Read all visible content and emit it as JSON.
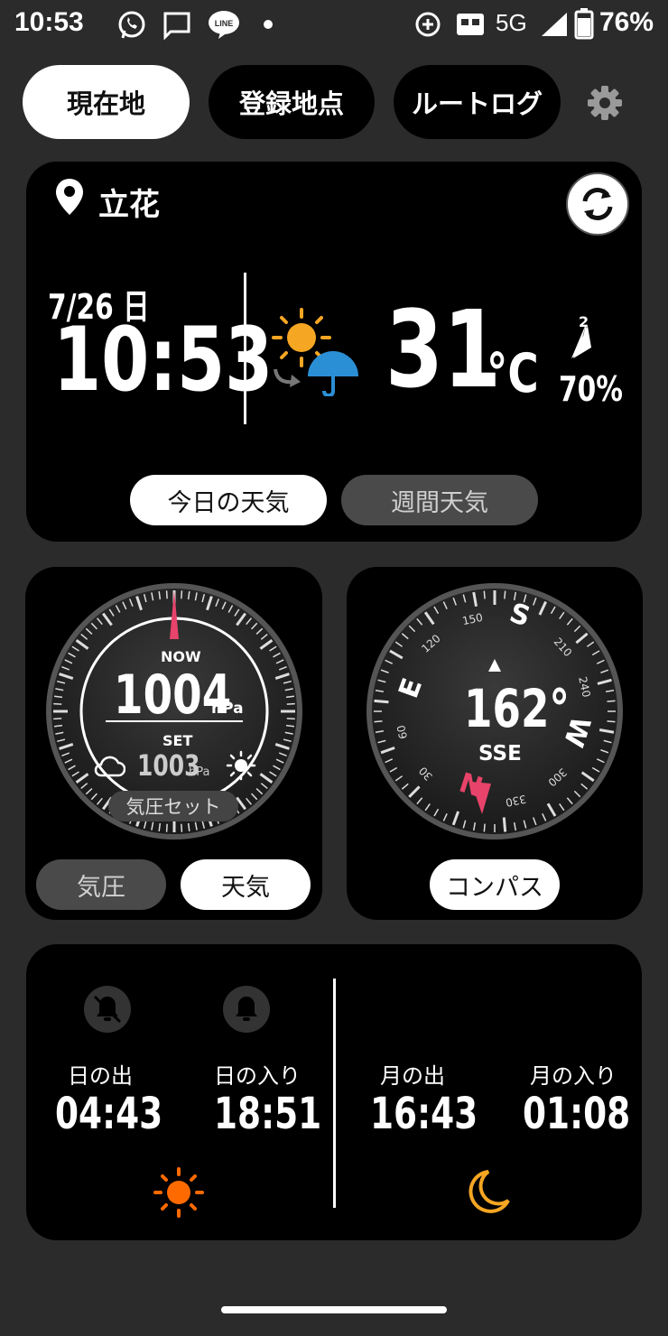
{
  "status_bar": {
    "time": "10:53",
    "network": "5G",
    "battery": "76%"
  },
  "tabs": [
    {
      "label": "現在地",
      "active": true
    },
    {
      "label": "登録地点",
      "active": false
    },
    {
      "label": "ルートログ",
      "active": false
    }
  ],
  "weather_card": {
    "location": "立花",
    "date": "7/26 日",
    "time": "10:53",
    "temperature": "31",
    "temp_unit": "°C",
    "rain_chance": "70%",
    "wind_level": "2",
    "buttons": {
      "today": "今日の天気",
      "weekly": "週間天気"
    }
  },
  "barometer_card": {
    "now_label": "NOW",
    "now_value": "1004",
    "now_unit": "hPa",
    "set_label": "SET",
    "set_value": "1003",
    "set_unit": "hPa",
    "set_button": "気圧セット",
    "buttons": {
      "pressure": "気圧",
      "weather": "天気"
    }
  },
  "compass_card": {
    "heading": "162°",
    "direction": "SSE",
    "cardinals": {
      "S": "S",
      "E": "E",
      "W": "W",
      "N": "N"
    },
    "degree_labels": [
      "150",
      "120",
      "210",
      "240",
      "60",
      "30",
      "300",
      "330"
    ],
    "button": "コンパス"
  },
  "sun_moon_card": {
    "sunrise_label": "日の出",
    "sunrise_time": "04:43",
    "sunset_label": "日の入り",
    "sunset_time": "18:51",
    "moonrise_label": "月の出",
    "moonrise_time": "16:43",
    "moonset_label": "月の入り",
    "moonset_time": "01:08"
  },
  "colors": {
    "background": "#2b2b2b",
    "card": "#000000",
    "sun": "#ff7a00",
    "moon": "#f5a623",
    "needle": "#e8436a",
    "umbrella": "#2b8fd6"
  }
}
